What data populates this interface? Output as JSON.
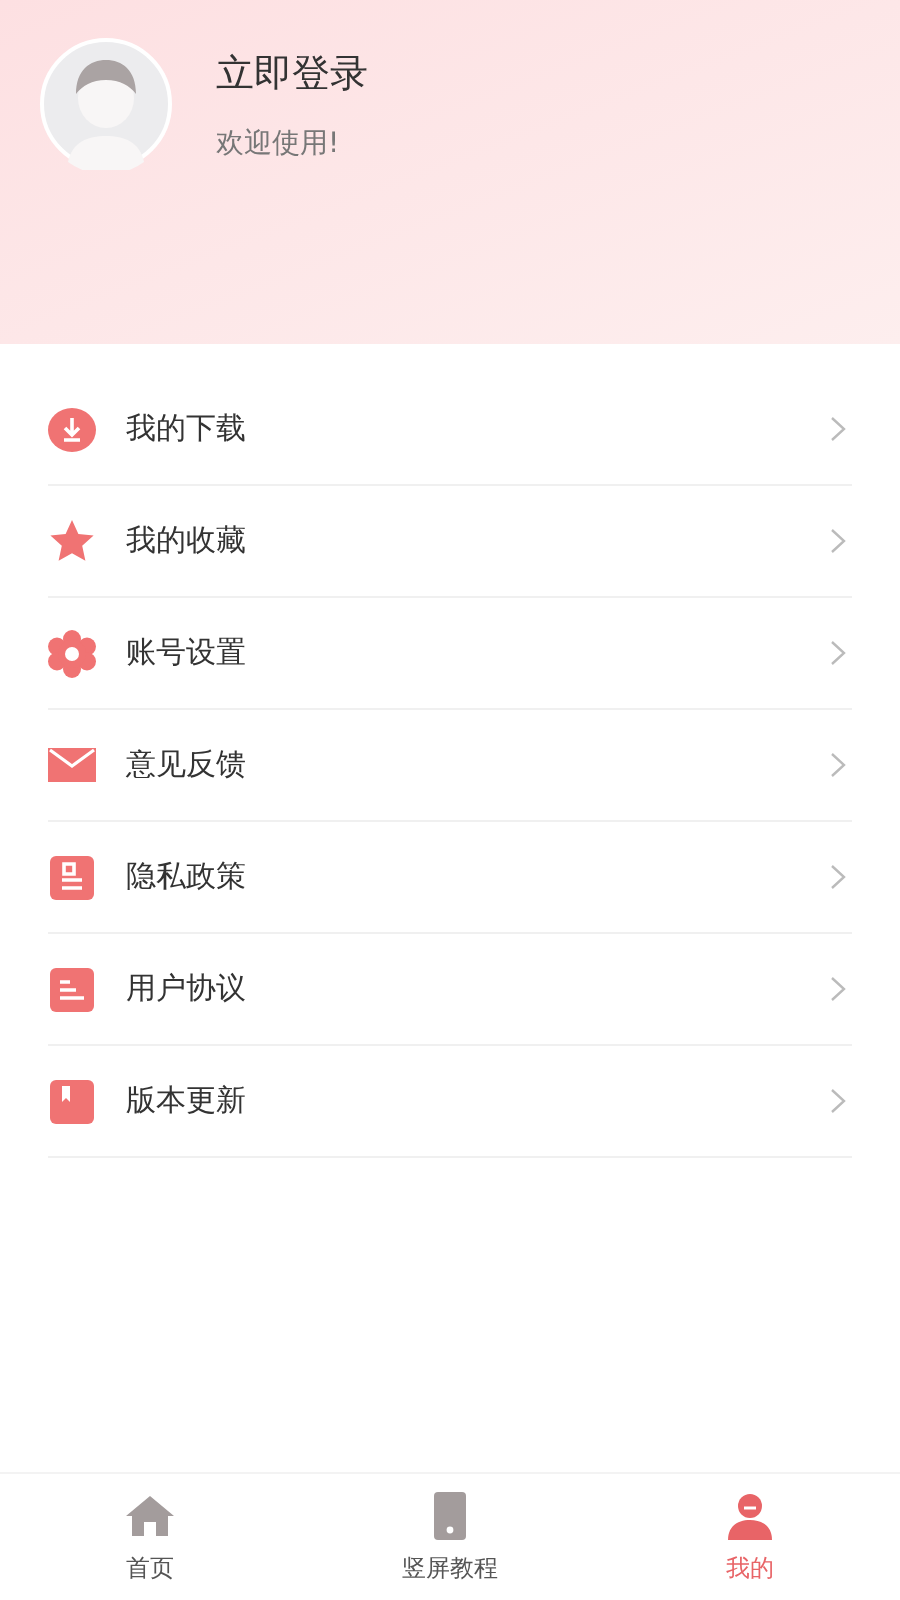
{
  "profile": {
    "title": "立即登录",
    "subtitle": "欢迎使用!"
  },
  "menu": [
    {
      "kind": "download",
      "label": "我的下载"
    },
    {
      "kind": "star",
      "label": "我的收藏"
    },
    {
      "kind": "gear",
      "label": "账号设置"
    },
    {
      "kind": "mail",
      "label": "意见反馈"
    },
    {
      "kind": "doc",
      "label": "隐私政策"
    },
    {
      "kind": "list",
      "label": "用户协议"
    },
    {
      "kind": "bookmark",
      "label": "版本更新"
    }
  ],
  "tabs": [
    {
      "kind": "home",
      "label": "首页",
      "selected": false
    },
    {
      "kind": "phone",
      "label": "竖屏教程",
      "selected": false
    },
    {
      "kind": "user",
      "label": "我的",
      "selected": true
    }
  ]
}
